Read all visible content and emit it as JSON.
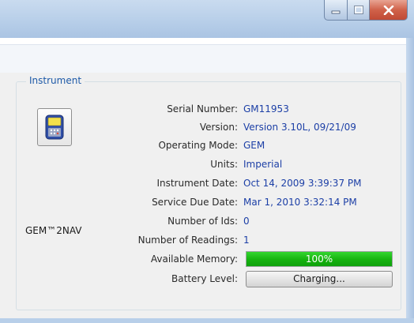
{
  "window": {
    "caption_buttons": {
      "minimize": "minimize-icon",
      "maximize": "maximize-icon",
      "close": "close-icon"
    }
  },
  "instrument": {
    "group_title": "Instrument",
    "device_name": "GEM™2NAV",
    "device_icon": "handheld-device-icon",
    "fields": [
      {
        "label": "Serial Number:",
        "value": "GM11953"
      },
      {
        "label": "Version:",
        "value": "Version 3.10L, 09/21/09"
      },
      {
        "label": "Operating Mode:",
        "value": "GEM"
      },
      {
        "label": "Units:",
        "value": "Imperial"
      },
      {
        "label": "Instrument Date:",
        "value": "Oct 14, 2009 3:39:37 PM"
      },
      {
        "label": "Service Due Date:",
        "value": "Mar 1, 2010 3:32:14 PM"
      },
      {
        "label": "Number of Ids:",
        "value": "0"
      },
      {
        "label": "Number of Readings:",
        "value": "1"
      }
    ],
    "memory": {
      "label": "Available Memory:",
      "percent_text": "100%",
      "fraction": 1.0
    },
    "battery": {
      "label": "Battery Level:",
      "status": "Charging..."
    }
  },
  "colors": {
    "accent": "#1e5aa8",
    "value_text": "#1c3fa6",
    "progress_green": "#15b20f",
    "close_red": "#c04a35"
  }
}
